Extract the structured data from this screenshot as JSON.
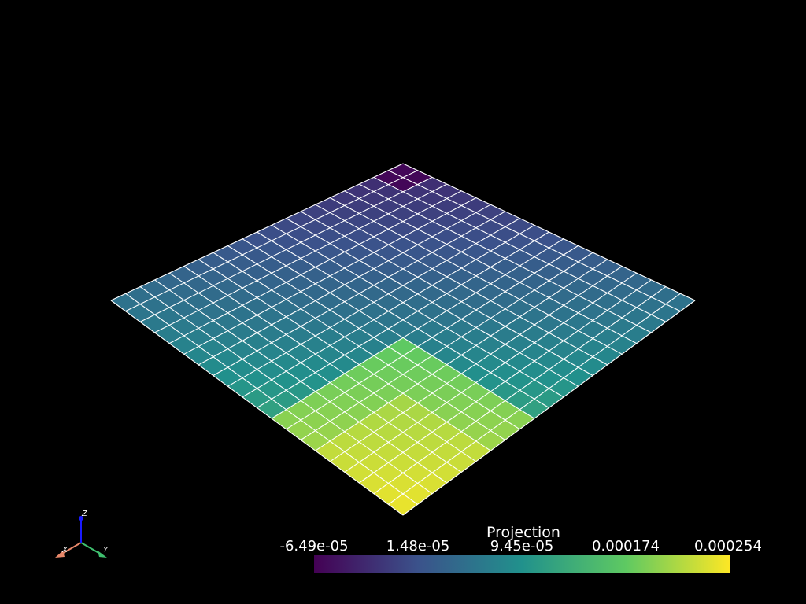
{
  "scalar_bar": {
    "title": "Projection",
    "tick_labels": [
      "-6.49e-05",
      "1.48e-05",
      "9.45e-05",
      "0.000174",
      "0.000254"
    ],
    "range": [
      -6.49e-05,
      0.000254
    ],
    "colormap": "viridis",
    "colormap_stops": [
      "#440154",
      "#3b528b",
      "#21918c",
      "#5ec962",
      "#fde725"
    ]
  },
  "axes_widget": {
    "x_label": "X",
    "y_label": "Y",
    "z_label": "Z",
    "x_color": "#e8886a",
    "y_color": "#3fbf6f",
    "z_color": "#1a1aff"
  },
  "mesh": {
    "rows": 20,
    "cols": 20,
    "edge_color": "#ffffff",
    "background": "#000000"
  }
}
